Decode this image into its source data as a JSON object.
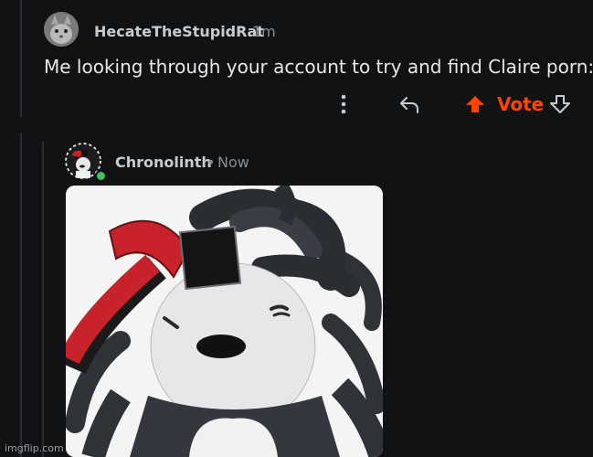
{
  "comment1": {
    "username": "HecateTheStupidRat",
    "time": "1m",
    "body": "Me looking through your account to try and find Claire porn:",
    "actions": {
      "more_icon": "vertical-dots-icon",
      "reply_icon": "reply-arrow-icon",
      "upvote_icon": "upvote-arrow-icon",
      "vote_label": "Vote",
      "downvote_icon": "downvote-arrow-icon"
    }
  },
  "comment2": {
    "username": "Chronolinth",
    "time": "Now",
    "separator": "•",
    "online": true,
    "image": "roblox-style-avatar-render"
  },
  "watermark": "imgflip.com",
  "colors": {
    "background": "#111214",
    "accent": "#ff4500",
    "thread_line": "#2a2c2f",
    "online": "#3fbf5f"
  }
}
